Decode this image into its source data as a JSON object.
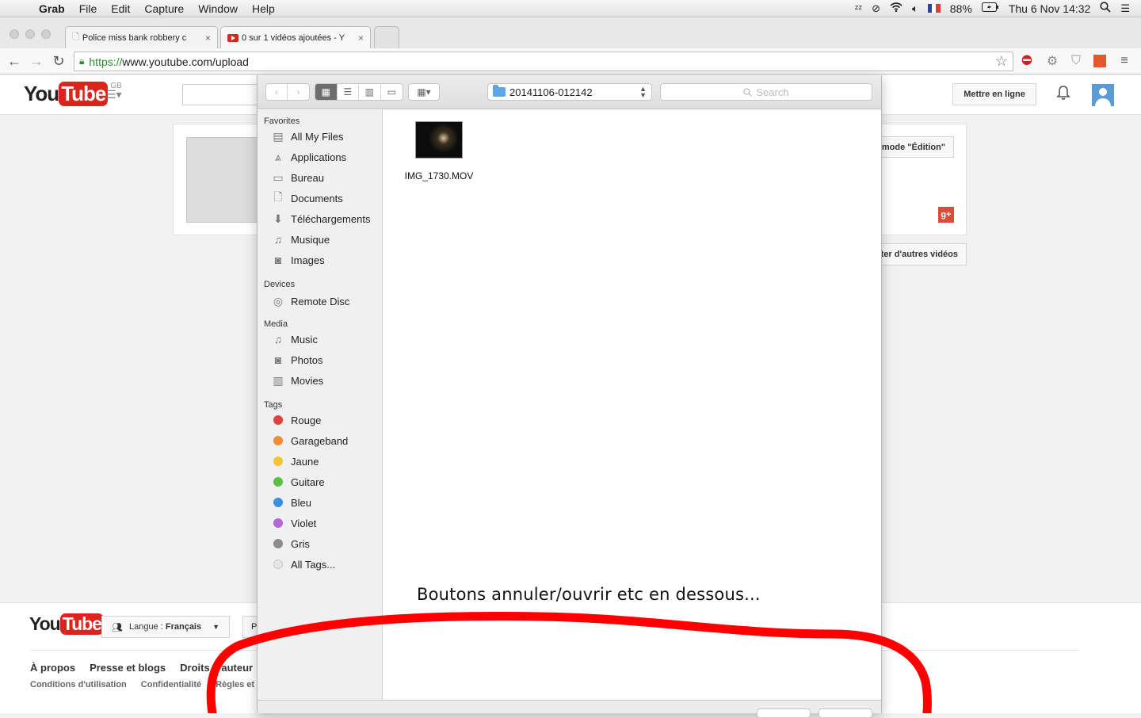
{
  "menubar": {
    "app": "Grab",
    "items": [
      "File",
      "Edit",
      "Capture",
      "Window",
      "Help"
    ],
    "battery": "88%",
    "datetime": "Thu 6 Nov  14:32"
  },
  "browser": {
    "tabs": [
      {
        "title": "Police miss bank robbery c",
        "active": false
      },
      {
        "title": "0 sur 1 vidéos ajoutées - Y",
        "active": true
      }
    ],
    "url_scheme": "https://",
    "url_rest": "www.youtube.com/upload"
  },
  "youtube": {
    "logo_you": "You",
    "logo_tube": "Tube",
    "region": "GB",
    "upload_button": "Mettre en ligne",
    "edit_button": "mode \"Édition\"",
    "other_videos_button": "ter d'autres vidéos",
    "footer": {
      "language_label": "Langue :",
      "language_value": "Français",
      "extra_button": "P",
      "links_row1": [
        "À propos",
        "Presse et blogs",
        "Droits d'auteur"
      ],
      "links_row2": [
        "Conditions d'utilisation",
        "Confidentialité",
        "Règles et"
      ]
    }
  },
  "dialog": {
    "path": "20141106-012142",
    "search_placeholder": "Search",
    "favorites_header": "Favorites",
    "favorites": [
      {
        "label": "All My Files",
        "icon": "all-files-icon"
      },
      {
        "label": "Applications",
        "icon": "applications-icon"
      },
      {
        "label": "Bureau",
        "icon": "desktop-icon"
      },
      {
        "label": "Documents",
        "icon": "documents-icon"
      },
      {
        "label": "Téléchargements",
        "icon": "downloads-icon"
      },
      {
        "label": "Musique",
        "icon": "music-icon"
      },
      {
        "label": "Images",
        "icon": "camera-icon"
      }
    ],
    "devices_header": "Devices",
    "devices": [
      {
        "label": "Remote Disc",
        "icon": "disc-icon"
      }
    ],
    "media_header": "Media",
    "media": [
      {
        "label": "Music",
        "icon": "music-icon"
      },
      {
        "label": "Photos",
        "icon": "camera-icon"
      },
      {
        "label": "Movies",
        "icon": "film-icon"
      }
    ],
    "tags_header": "Tags",
    "tags": [
      {
        "label": "Rouge",
        "color": "#e0413a"
      },
      {
        "label": "Garageband",
        "color": "#ef8d31"
      },
      {
        "label": "Jaune",
        "color": "#f4c531"
      },
      {
        "label": "Guitare",
        "color": "#5cbf42"
      },
      {
        "label": "Bleu",
        "color": "#3b8fe0"
      },
      {
        "label": "Violet",
        "color": "#b865d6"
      },
      {
        "label": "Gris",
        "color": "#8d8d8d"
      },
      {
        "label": "All Tags...",
        "color": "#e6e6e6"
      }
    ],
    "files": [
      {
        "name": "IMG_1730.MOV"
      }
    ]
  },
  "annotation": {
    "text": "Boutons annuler/ouvrir etc en dessous...",
    "color": "#ff0000"
  }
}
